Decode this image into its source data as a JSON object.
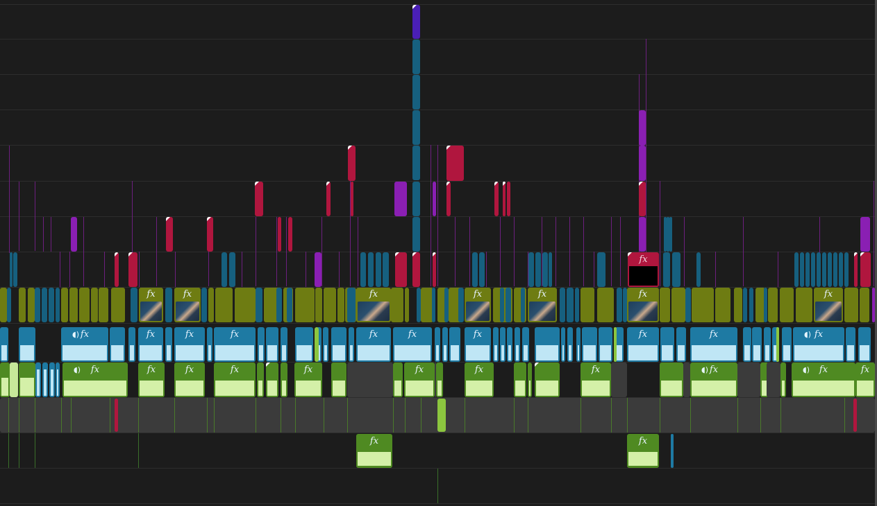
{
  "colors": {
    "background": "#1c1c1c",
    "track_line": "#2d2d2d",
    "video_olive": "#6e7c12",
    "video_teal": "#16607f",
    "audio_blue": "#1e7aa3",
    "audio_green": "#4f8a22",
    "title_magenta": "#b0163e",
    "adjust_purple": "#8a1fb3",
    "gap_gray": "#3b3b3b"
  },
  "clip_label": "fx",
  "icons": [
    "effects-badge-icon",
    "voice-isolation-icon",
    "marker-flag-icon",
    "thumbnail-icon"
  ]
}
